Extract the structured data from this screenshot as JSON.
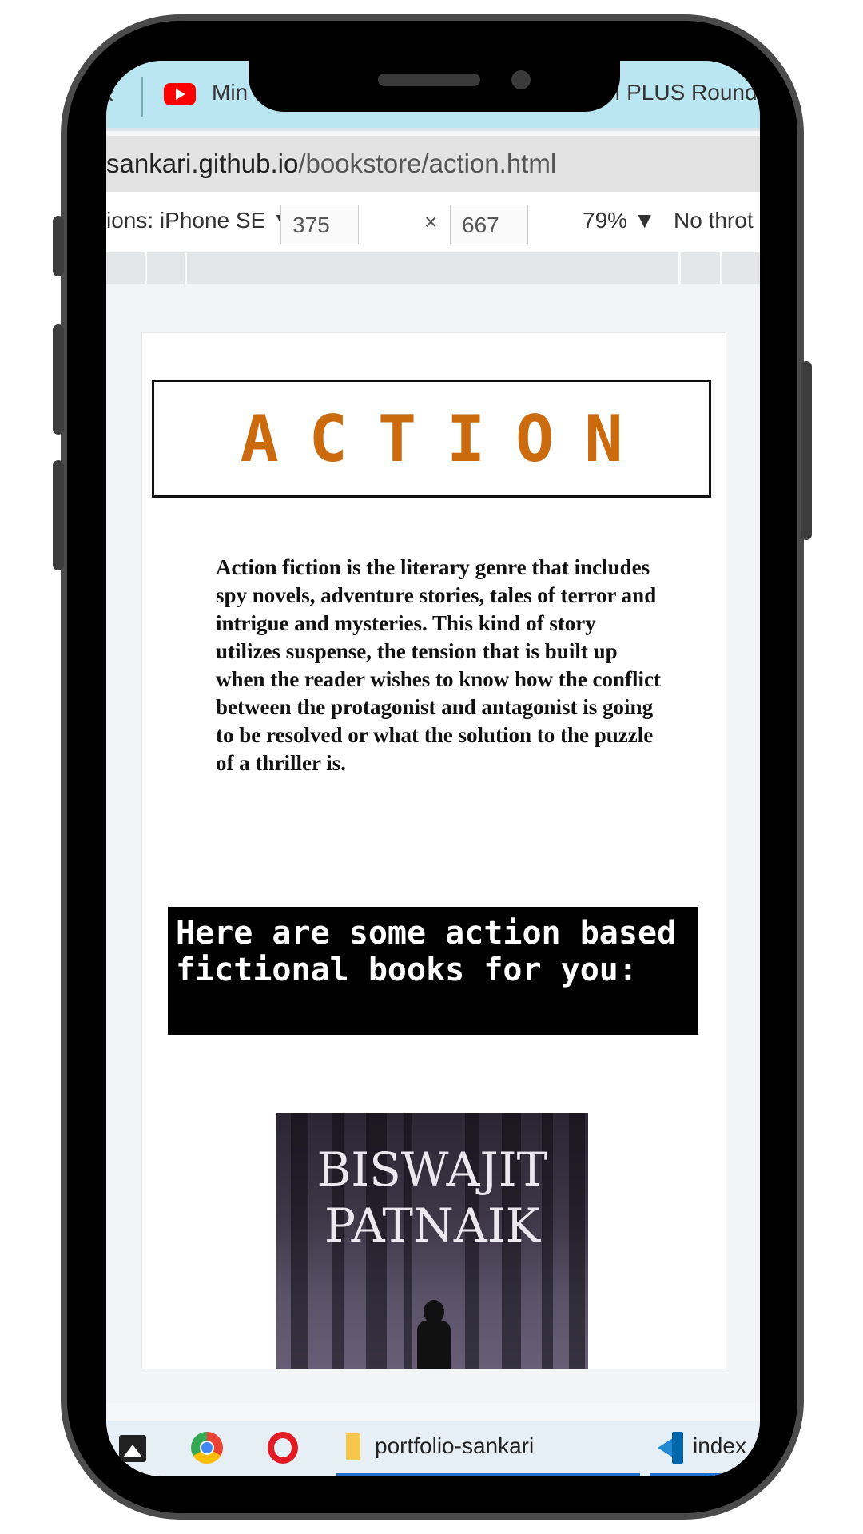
{
  "browser": {
    "tab_1_title": "Min",
    "tab_2_title": "M PLUS Round",
    "url_host": "sankari.github.io",
    "url_path": "/bookstore/action.html"
  },
  "devtools": {
    "device": "ions: iPhone SE ▼",
    "width": "375",
    "height": "667",
    "times": "×",
    "zoom": "79% ▼",
    "throttle": "No throt"
  },
  "page": {
    "heading": "ACTION",
    "description": "Action fiction is the literary genre that includes spy novels, adventure stories, tales of terror and intrigue and mysteries. This kind of story utilizes suspense, the tension that is built up when the reader wishes to know how the conflict between the protagonist and antagonist is going to be resolved or what the solution to the puzzle of a thriller is.",
    "intro": "Here are some action based fictional books for you:",
    "book_author_line1": "BISWAJIT",
    "book_author_line2": "PATNAIK"
  },
  "taskbar": {
    "folder_label": "portfolio-sankari",
    "vscode_label": "index"
  },
  "icons": [
    "youtube-icon",
    "photos-icon",
    "chrome-icon",
    "opera-icon",
    "folder-icon",
    "vscode-icon"
  ],
  "colors": {
    "heading": "#cc6a0e",
    "tab_strip": "#b9e6f1",
    "intro_bg": "#000000"
  }
}
